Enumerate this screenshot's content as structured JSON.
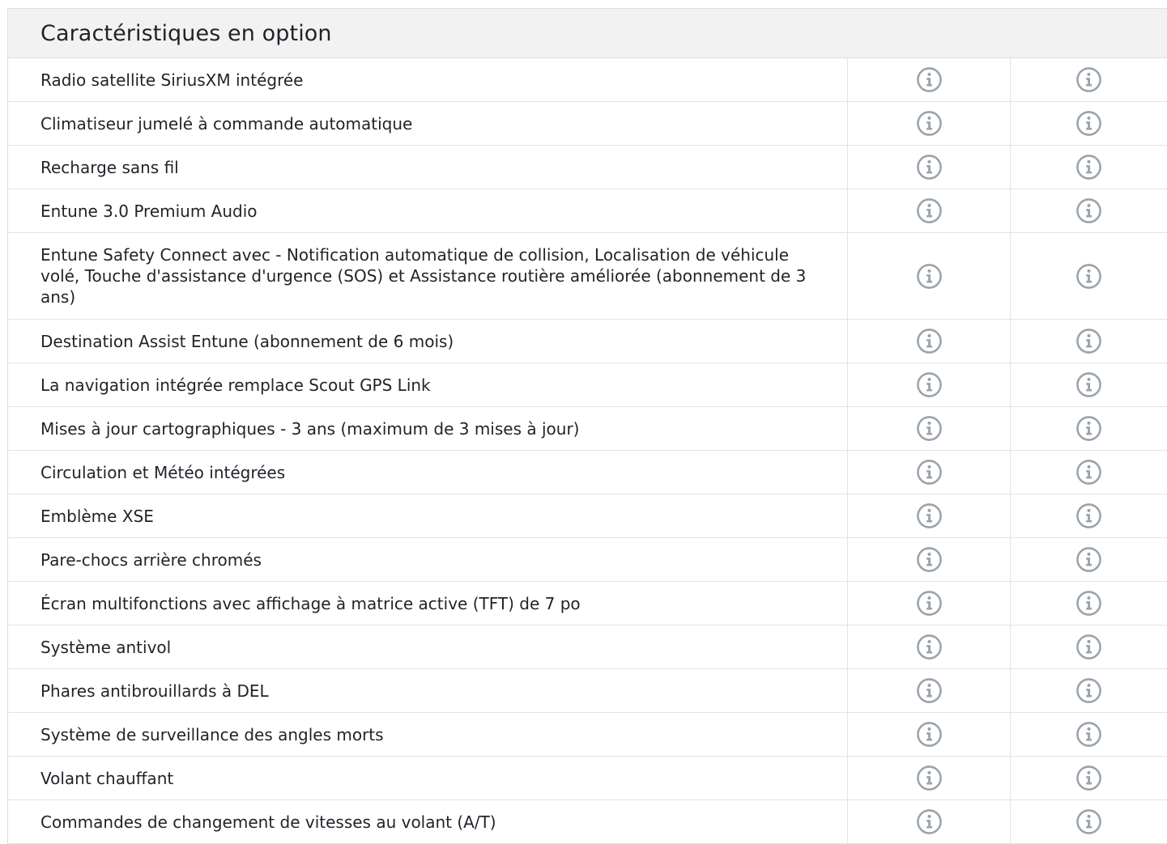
{
  "section": {
    "title": "Caractéristiques en option"
  },
  "icons": {
    "info": "info-circle-icon",
    "color": "#9aa3ab"
  },
  "features": [
    {
      "label": "Radio satellite SiriusXM intégrée"
    },
    {
      "label": "Climatiseur jumelé à commande automatique"
    },
    {
      "label": "Recharge sans fil"
    },
    {
      "label": "Entune 3.0 Premium Audio"
    },
    {
      "label": "Entune Safety Connect avec - Notification automatique de collision, Localisation de véhicule volé, Touche d'assistance d'urgence (SOS) et Assistance routière améliorée (abonnement de 3 ans)"
    },
    {
      "label": "Destination Assist Entune (abonnement de 6 mois)"
    },
    {
      "label": "La navigation intégrée remplace Scout GPS Link"
    },
    {
      "label": "Mises à jour cartographiques - 3 ans (maximum de 3 mises à jour)"
    },
    {
      "label": "Circulation et Météo intégrées"
    },
    {
      "label": "Emblème XSE"
    },
    {
      "label": "Pare-chocs arrière chromés"
    },
    {
      "label": "Écran multifonctions avec affichage à matrice active (TFT) de 7 po"
    },
    {
      "label": "Système antivol"
    },
    {
      "label": "Phares antibrouillards à DEL"
    },
    {
      "label": "Système de surveillance des angles morts"
    },
    {
      "label": "Volant chauffant"
    },
    {
      "label": "Commandes de changement de vitesses au volant (A/T)"
    }
  ]
}
